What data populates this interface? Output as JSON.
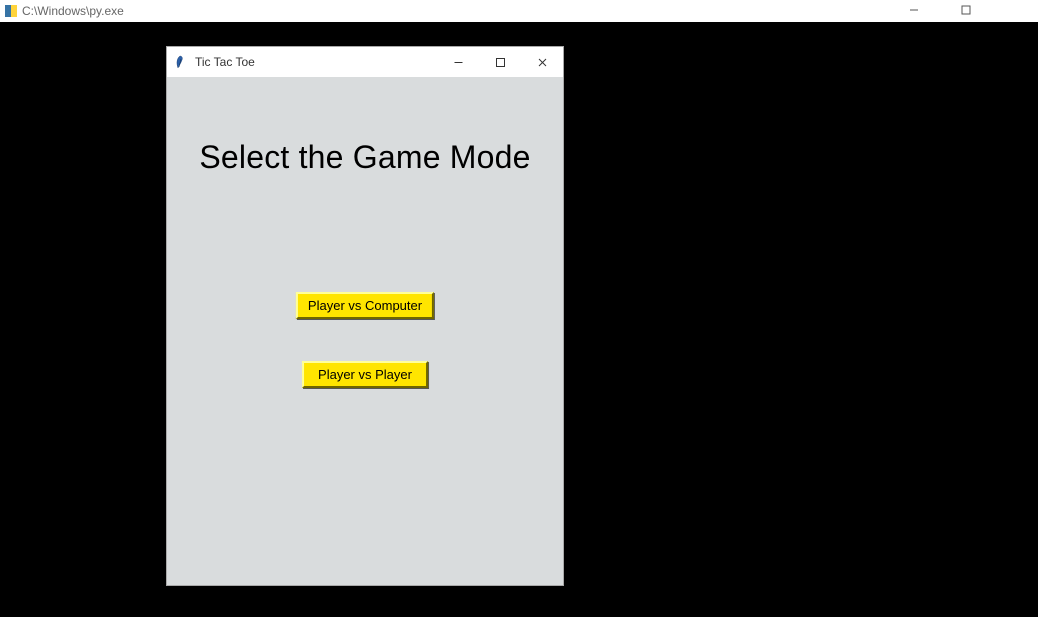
{
  "outer_window": {
    "title": "C:\\Windows\\py.exe"
  },
  "tk_window": {
    "title": "Tic Tac Toe",
    "heading": "Select the Game Mode",
    "buttons": {
      "pvc": "Player vs Computer",
      "pvp": "Player vs Player"
    }
  }
}
